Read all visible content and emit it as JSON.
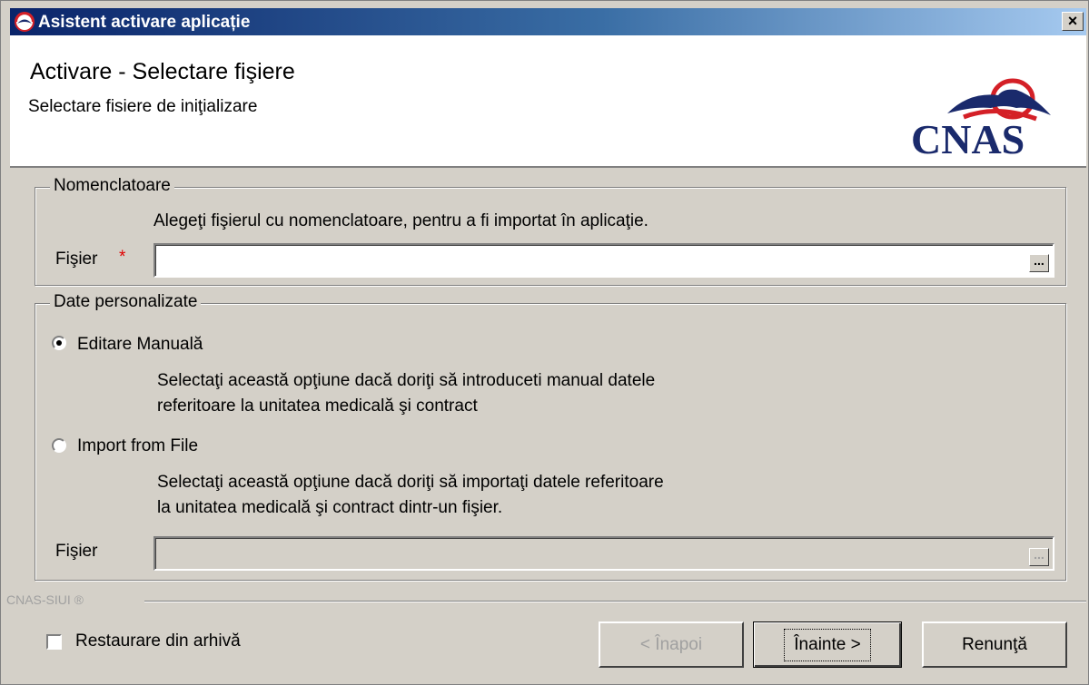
{
  "window": {
    "title": "Asistent activare aplicație",
    "close_label": "×"
  },
  "header": {
    "title": "Activare - Selectare fişiere",
    "subtitle": "Selectare fisiere de iniţializare",
    "logo_text": "CNAS"
  },
  "nomenclatoare": {
    "legend": "Nomenclatoare",
    "description": "Alegeţi fişierul cu nomenclatoare, pentru a fi importat în aplicaţie.",
    "file_label": "Fişier",
    "required_mark": "*",
    "file_value": "",
    "browse_label": "..."
  },
  "date_personalizate": {
    "legend": "Date personalizate",
    "options": [
      {
        "label": "Editare Manuală",
        "selected": true,
        "description_line1": "Selectaţi această opţiune dacă doriţi să introduceti manual datele",
        "description_line2": "referitoare la unitatea medicală şi contract"
      },
      {
        "label": "Import from File",
        "selected": false,
        "description_line1": "Selectaţi această opţiune dacă doriţi să importaţi datele referitoare",
        "description_line2": "la unitatea medicală şi contract dintr-un fişier."
      }
    ],
    "file_label": "Fişier",
    "file_value": "",
    "browse_label": "..."
  },
  "footer": {
    "brand": "CNAS-SIUI ®",
    "restore_label": "Restaurare din arhivă",
    "restore_checked": false,
    "back_label": "< Înapoi",
    "next_label": "Înainte >",
    "cancel_label": "Renunţă"
  },
  "colors": {
    "titlebar_start": "#0a246a",
    "titlebar_end": "#a6caf0",
    "dialog_bg": "#d4d0c8",
    "logo_red": "#d42027",
    "logo_navy": "#1a2a6c",
    "required_red": "#e00000"
  }
}
